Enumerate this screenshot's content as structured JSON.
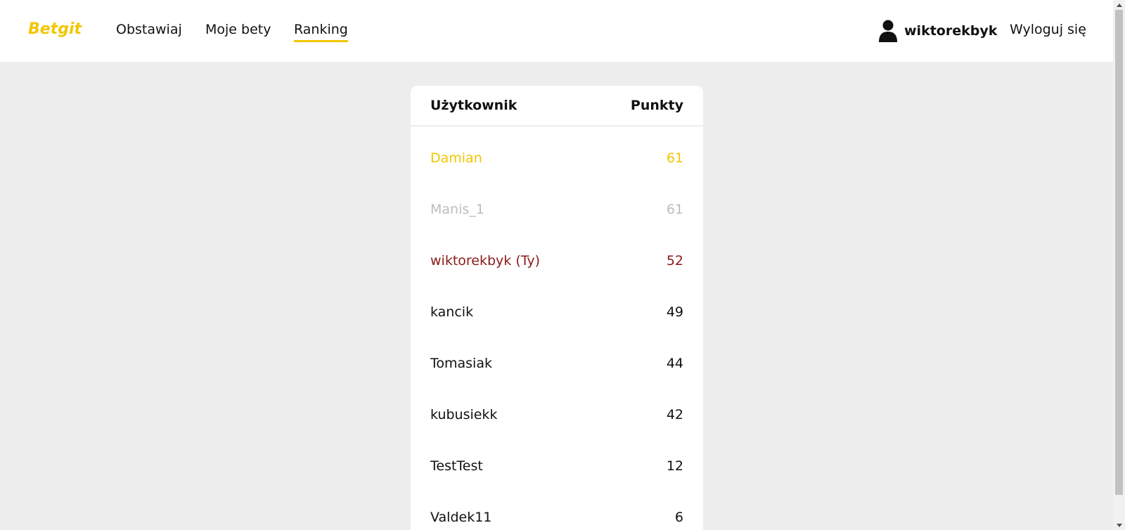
{
  "colors": {
    "brand": "#f2c600",
    "gold": "#f2c600",
    "silver": "#bdbdbd",
    "current_user": "#8b1a1a",
    "text": "#111111"
  },
  "header": {
    "brand": "Betgit",
    "nav": [
      {
        "label": "Obstawiaj",
        "active": false
      },
      {
        "label": "Moje bety",
        "active": false
      },
      {
        "label": "Ranking",
        "active": true
      }
    ],
    "user": {
      "icon": "user-icon",
      "name": "wiktorekbyk"
    },
    "logout_label": "Wyloguj się"
  },
  "ranking": {
    "columns": {
      "user": "Użytkownik",
      "points": "Punkty"
    },
    "rows": [
      {
        "user": "Damian",
        "points": "61",
        "style": "gold"
      },
      {
        "user": "Manis_1",
        "points": "61",
        "style": "silver"
      },
      {
        "user": "wiktorekbyk (Ty)",
        "points": "52",
        "style": "current_user"
      },
      {
        "user": "kancik",
        "points": "49",
        "style": "text"
      },
      {
        "user": "Tomasiak",
        "points": "44",
        "style": "text"
      },
      {
        "user": "kubusiekk",
        "points": "42",
        "style": "text"
      },
      {
        "user": "TestTest",
        "points": "12",
        "style": "text"
      },
      {
        "user": "Valdek11",
        "points": "6",
        "style": "text"
      }
    ]
  },
  "scrollbar": {
    "icons": [
      "scroll-up-arrow-icon",
      "scroll-down-arrow-icon"
    ]
  }
}
